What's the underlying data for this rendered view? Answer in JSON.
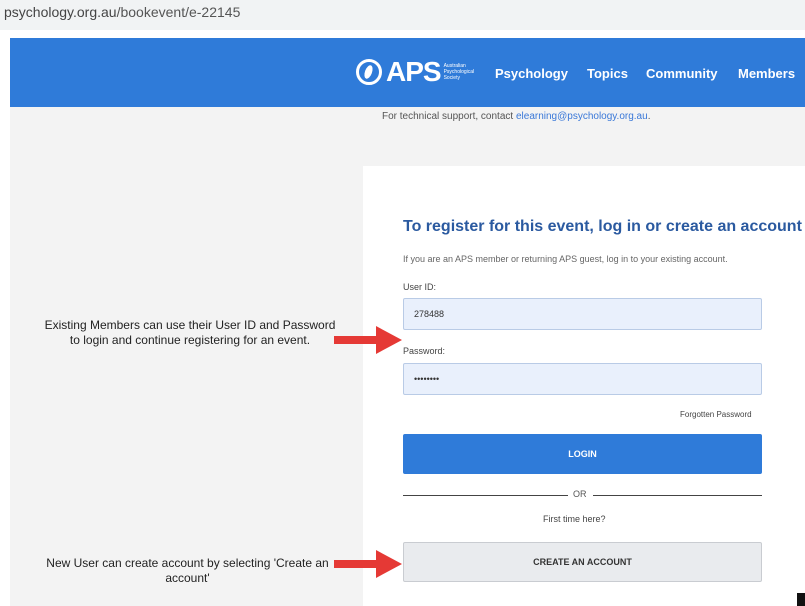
{
  "browser": {
    "url_domain": "psychology.org.au",
    "url_path": "/bookevent/e-22145"
  },
  "header": {
    "brand_color": "#2f7bd9",
    "logo": {
      "text": "APS",
      "subtitle": "Australian Psychological Society"
    },
    "nav": [
      "Psychology",
      "Topics",
      "Community",
      "Members"
    ]
  },
  "support": {
    "text": "For technical support, contact ",
    "email": "elearning@psychology.org.au",
    "suffix": "."
  },
  "login": {
    "title": "To register for this event, log in or create an account",
    "subtitle": "If you are an APS member or returning APS guest, log in to your existing account.",
    "user_id_label": "User ID:",
    "user_id_value": "278488",
    "password_label": "Password:",
    "password_value": "••••••••",
    "forgot_label": "Forgotten Password",
    "login_button": "LOGIN",
    "or_text": "OR",
    "first_time": "First time here?",
    "create_button": "CREATE AN ACCOUNT"
  },
  "annotations": {
    "members": "Existing Members can use their User ID and Password to login and continue registering for an event.",
    "new_user": "New User can create account by selecting 'Create an account'",
    "arrow_color": "#e53935"
  }
}
